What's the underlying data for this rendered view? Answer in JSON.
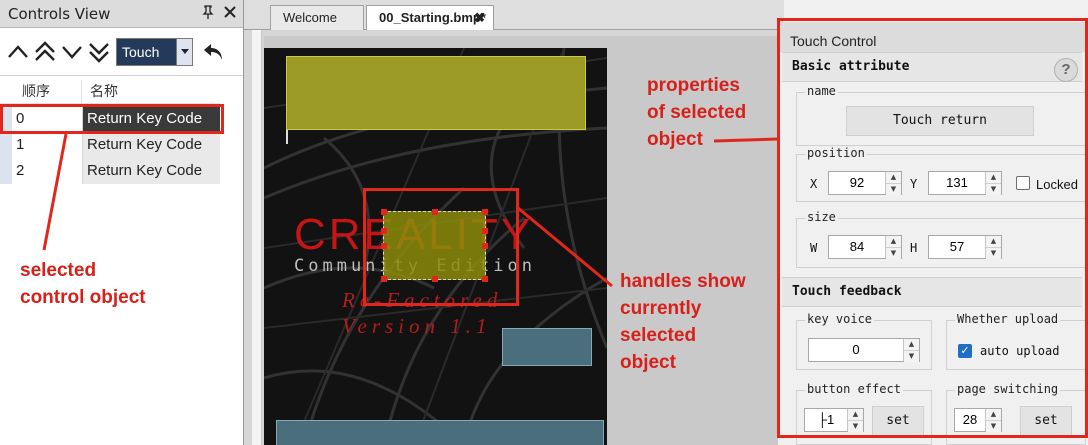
{
  "controls_view": {
    "title": "Controls View",
    "pin_glyph": "Ÿ",
    "close_glyph": "✖",
    "type_selector": {
      "value": "Touch"
    },
    "list_headers": {
      "order": "顺序",
      "name": "名称"
    },
    "rows": [
      {
        "order": "0",
        "name": "Return Key Code",
        "selected": true
      },
      {
        "order": "1",
        "name": "Return Key Code",
        "selected": false
      },
      {
        "order": "2",
        "name": "Return Key Code",
        "selected": false
      }
    ]
  },
  "editor": {
    "tabs": [
      {
        "label": "Welcome",
        "active": false
      },
      {
        "label": "00_Starting.bmp*",
        "active": true,
        "close": "✖"
      }
    ]
  },
  "screen": {
    "logo": "CREALITY",
    "subtitle": "Community Edition",
    "line1": "Re-Factored",
    "line2": "Version 1.1"
  },
  "properties": {
    "title": "Touch Control",
    "basic_attribute": "Basic attribute",
    "help": "?",
    "name_group": "name",
    "name_value": "Touch return",
    "position_group": "position",
    "x_label": "X",
    "x_value": "92",
    "y_label": "Y",
    "y_value": "131",
    "locked_label": "Locked",
    "size_group": "size",
    "w_label": "W",
    "w_value": "84",
    "h_label": "H",
    "h_value": "57",
    "touch_feedback": "Touch feedback",
    "key_voice_group": "key voice",
    "key_voice_value": "0",
    "upload_group": "Whether upload",
    "auto_upload_label": "auto upload",
    "button_effect_group": "button effect",
    "button_effect_value": "├1",
    "set_label": "set",
    "page_switch_group": "page switching",
    "page_switch_value": "28"
  },
  "annotations": {
    "props_note": [
      "properties",
      "of selected",
      "object"
    ],
    "selected_note": [
      "selected",
      "control object"
    ],
    "handles_note": [
      "handles show",
      "currently",
      "selected",
      "object"
    ],
    "color": "#e1261c"
  }
}
